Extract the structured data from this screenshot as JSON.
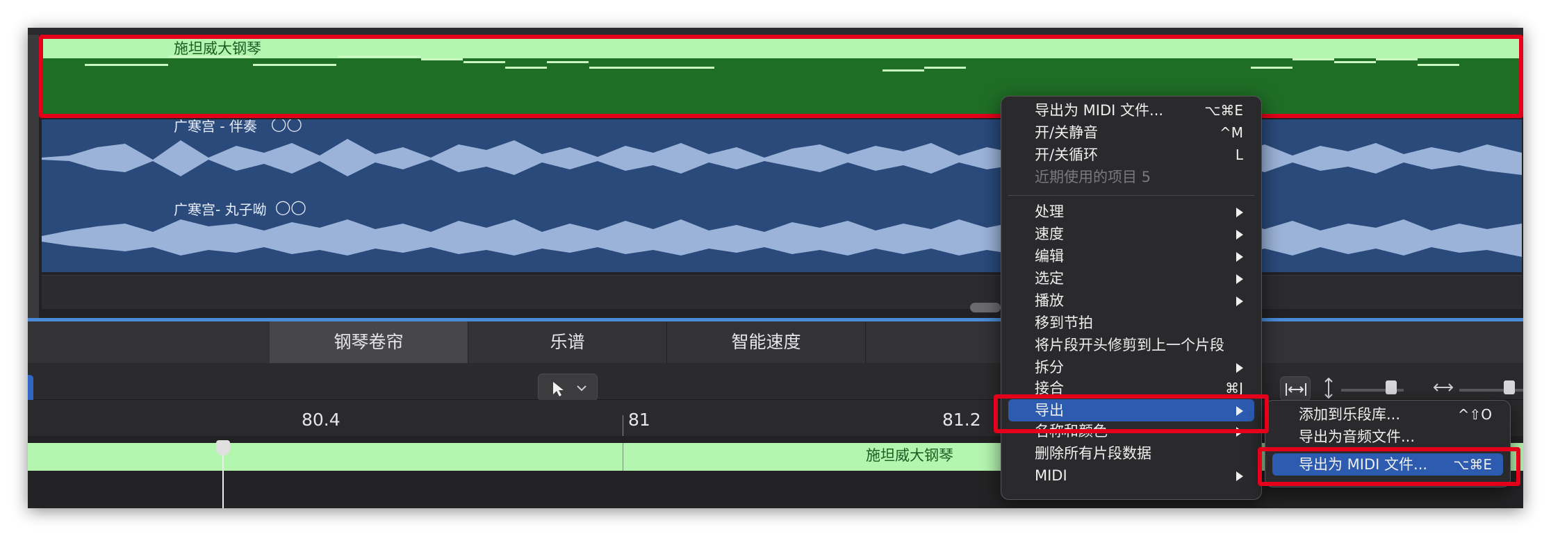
{
  "tracks": {
    "midi_region": {
      "title": "施坦威大钢琴"
    },
    "audio_region_1": {
      "title": "广寒宫 - 伴奏",
      "icon": "loop-rings-icon"
    },
    "audio_region_2": {
      "title": "广寒宫- 丸子呦",
      "icon": "loop-rings-icon"
    }
  },
  "editor": {
    "tabs": [
      {
        "label": "钢琴卷帘",
        "active": true
      },
      {
        "label": "乐谱",
        "active": false
      },
      {
        "label": "智能速度",
        "active": false
      }
    ],
    "toolbar": {
      "pointer_tool_icon": "pointer-arrow-icon"
    },
    "ruler": {
      "labels": [
        "80.4",
        "81",
        "81.2"
      ]
    },
    "region_lane": {
      "title": "施坦威大钢琴"
    }
  },
  "context_menu": {
    "items": [
      {
        "label": "导出为 MIDI 文件...",
        "shortcut": "⌥⌘E"
      },
      {
        "label": "开/关静音",
        "shortcut": "^M"
      },
      {
        "label": "开/关循环",
        "shortcut": "L"
      },
      {
        "label": "近期使用的项目 5",
        "disabled": true
      },
      {
        "label": "处理",
        "submenu": true
      },
      {
        "label": "速度",
        "submenu": true
      },
      {
        "label": "编辑",
        "submenu": true
      },
      {
        "label": "选定",
        "submenu": true
      },
      {
        "label": "播放",
        "submenu": true
      },
      {
        "label": "移到节拍"
      },
      {
        "label": "将片段开头修剪到上一个片段"
      },
      {
        "label": "拆分",
        "submenu": true
      },
      {
        "label": "接合",
        "shortcut": "⌘J"
      },
      {
        "label": "导出",
        "submenu": true,
        "highlighted": true
      },
      {
        "label": "名称和颜色",
        "submenu": true
      },
      {
        "label": "删除所有片段数据"
      },
      {
        "label": "MIDI",
        "submenu": true
      }
    ]
  },
  "export_submenu": {
    "items": [
      {
        "label": "添加到乐段库...",
        "shortcut": "^⇧O"
      },
      {
        "label": "导出为音频文件..."
      },
      {
        "label": "导出为 MIDI 文件...",
        "shortcut": "⌥⌘E",
        "highlighted": true
      }
    ]
  },
  "colors": {
    "midi_region": "#1f6e26",
    "midi_header": "#b4f5b0",
    "audio_region": "#2a4a7c",
    "waveform": "#9bb3d8",
    "menu_highlight": "#2c5bb0",
    "annotation_red": "#e4001b"
  }
}
